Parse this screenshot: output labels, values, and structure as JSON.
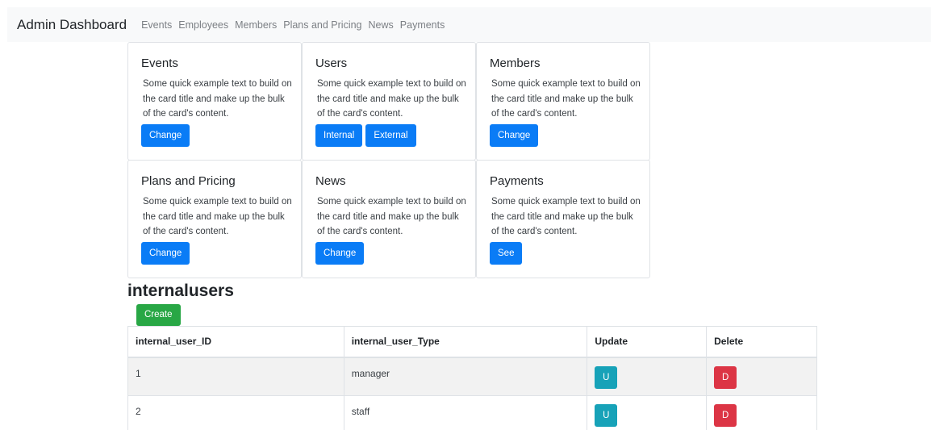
{
  "navbar": {
    "brand": "Admin Dashboard",
    "links": [
      "Events",
      "Employees",
      "Members",
      "Plans and Pricing",
      "News",
      "Payments"
    ]
  },
  "cards": [
    {
      "title": "Events",
      "text": "Some quick example text to build on the card title and make up the bulk of the card's content.",
      "buttons": [
        "Change"
      ]
    },
    {
      "title": "Users",
      "text": "Some quick example text to build on the card title and make up the bulk of the card's content.",
      "buttons": [
        "Internal",
        "External"
      ]
    },
    {
      "title": "Members",
      "text": "Some quick example text to build on the card title and make up the bulk of the card's content.",
      "buttons": [
        "Change"
      ]
    },
    {
      "title": "Plans and Pricing",
      "text": "Some quick example text to build on the card title and make up the bulk of the card's content.",
      "buttons": [
        "Change"
      ]
    },
    {
      "title": "News",
      "text": "Some quick example text to build on the card title and make up the bulk of the card's content.",
      "buttons": [
        "Change"
      ]
    },
    {
      "title": "Payments",
      "text": "Some quick example text to build on the card title and make up the bulk of the card's content.",
      "buttons": [
        "See"
      ]
    }
  ],
  "section": {
    "title": "internalusers",
    "create_label": "Create"
  },
  "table": {
    "headers": [
      "internal_user_ID",
      "internal_user_Type",
      "Update",
      "Delete"
    ],
    "rows": [
      {
        "id": "1",
        "type": "manager",
        "update_label": "U",
        "delete_label": "D"
      },
      {
        "id": "2",
        "type": "staff",
        "update_label": "U",
        "delete_label": "D"
      }
    ]
  },
  "colors": {
    "primary": "#0a7cf6",
    "success": "#28a745",
    "info": "#17a2b8",
    "danger": "#dc3545",
    "navbar_bg": "#f8f9fa"
  }
}
